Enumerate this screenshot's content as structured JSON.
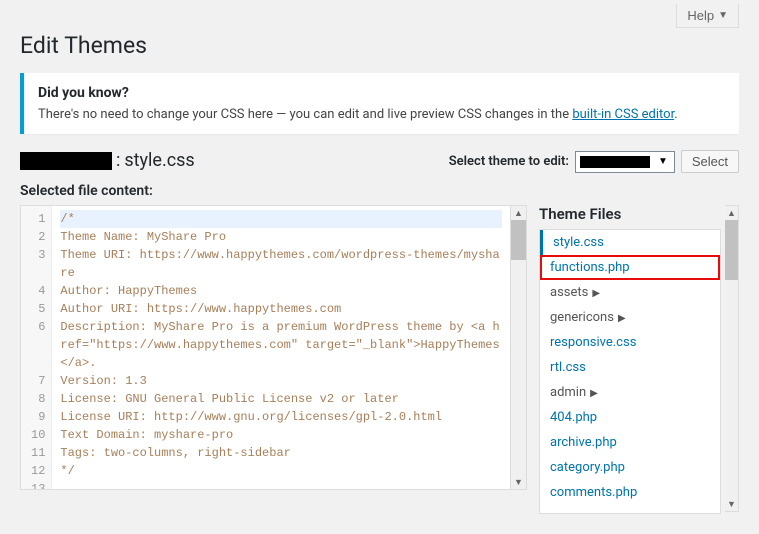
{
  "topbar": {
    "help_label": "Help"
  },
  "page_title": "Edit Themes",
  "notice": {
    "heading": "Did you know?",
    "body_prefix": "There's no need to change your CSS here — you can edit and live preview CSS changes in the ",
    "link_text": "built-in CSS editor",
    "body_suffix": "."
  },
  "current_file": {
    "separator": ": ",
    "filename": "style.css"
  },
  "theme_picker": {
    "label": "Select theme to edit:",
    "button": "Select"
  },
  "selected_file_label": "Selected file content:",
  "code_lines": [
    "/*",
    "Theme Name: MyShare Pro",
    "Theme URI: https://www.happythemes.com/wordpress-themes/myshare",
    "Author: HappyThemes",
    "Author URI: https://www.happythemes.com",
    "Description: MyShare Pro is a premium WordPress theme by <a href=\"https://www.happythemes.com\" target=\"_blank\">HappyThemes</a>.",
    "Version: 1.3",
    "License: GNU General Public License v2 or later",
    "License URI: http://www.gnu.org/licenses/gpl-2.0.html",
    "Text Domain: myshare-pro",
    "Tags: two-columns, right-sidebar",
    "*/",
    ""
  ],
  "files_heading": "Theme Files",
  "files": [
    {
      "name": "style.css",
      "active": true
    },
    {
      "name": "functions.php",
      "highlighted": true
    },
    {
      "name": "assets",
      "expandable": true
    },
    {
      "name": "genericons",
      "expandable": true
    },
    {
      "name": "responsive.css"
    },
    {
      "name": "rtl.css"
    },
    {
      "name": "admin",
      "expandable": true
    },
    {
      "name": "404.php"
    },
    {
      "name": "archive.php"
    },
    {
      "name": "category.php"
    },
    {
      "name": "comments.php"
    }
  ]
}
